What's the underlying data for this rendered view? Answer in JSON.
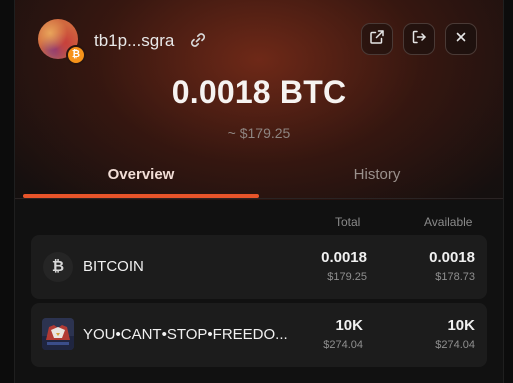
{
  "wallet": {
    "address_short": "tb1p...sgra",
    "avatar_badge": "₿"
  },
  "actions": {
    "open_external_icon": "external-link-icon",
    "logout_icon": "logout-icon",
    "close_icon": "close-icon"
  },
  "balance": {
    "amount": "0.0018 BTC",
    "fiat": "~ $179.25"
  },
  "tabs": [
    {
      "label": "Overview",
      "active": true
    },
    {
      "label": "History",
      "active": false
    }
  ],
  "table": {
    "headers": {
      "total": "Total",
      "available": "Available"
    },
    "rows": [
      {
        "icon": "bitcoin-icon",
        "icon_glyph": "₿",
        "name": "BITCOIN",
        "total": "0.0018",
        "total_fiat": "$179.25",
        "available": "0.0018",
        "available_fiat": "$178.73"
      },
      {
        "icon": "token-image-icon",
        "name": "YOU•CANT•STOP•FREEDO...",
        "total": "10K",
        "total_fiat": "$274.04",
        "available": "10K",
        "available_fiat": "$274.04"
      }
    ]
  },
  "colors": {
    "accent": "#e8542a",
    "background": "#111111",
    "row_background": "#1c1c1c"
  }
}
